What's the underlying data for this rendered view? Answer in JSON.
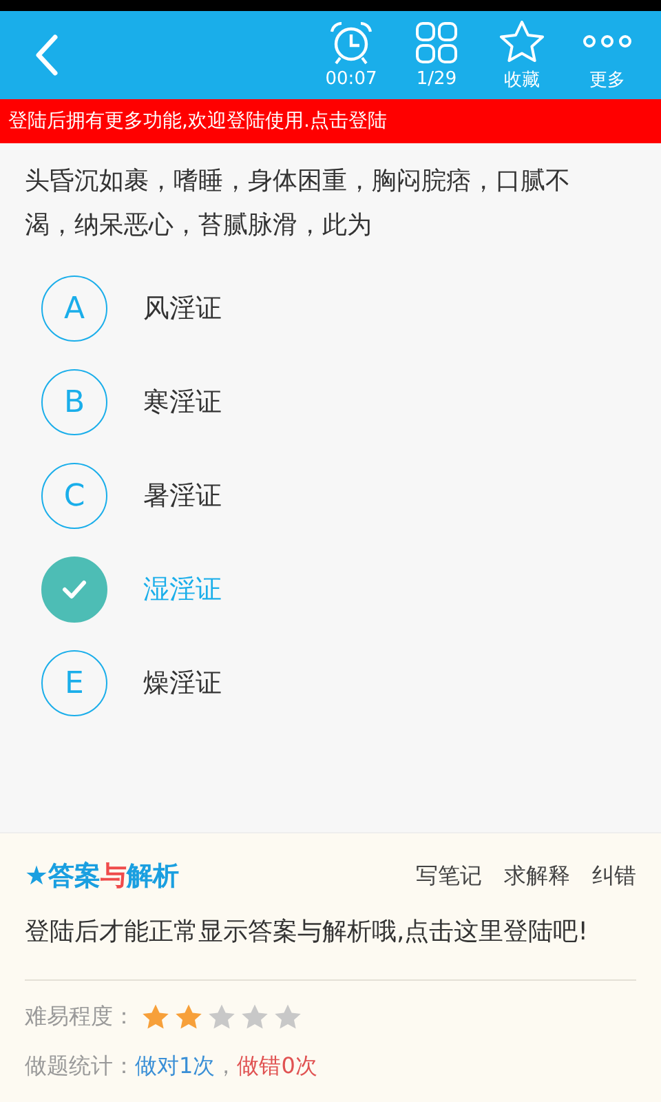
{
  "toolbar": {
    "items": [
      {
        "kind": "alarm",
        "label": "00:07"
      },
      {
        "kind": "grid",
        "label": "1/29"
      },
      {
        "kind": "star",
        "label": "收藏"
      },
      {
        "kind": "more",
        "label": "更多"
      }
    ]
  },
  "login_banner": "登陆后拥有更多功能,欢迎登陆使用.点击登陆",
  "question": "头昏沉如裹，嗜睡，身体困重，胸闷脘痞，口腻不渴，纳呆恶心，苔腻脉滑，此为",
  "options": [
    {
      "letter": "A",
      "text": "风淫证",
      "selected": false
    },
    {
      "letter": "B",
      "text": "寒淫证",
      "selected": false
    },
    {
      "letter": "C",
      "text": "暑淫证",
      "selected": false
    },
    {
      "text": "湿淫证",
      "selected": true
    },
    {
      "letter": "E",
      "text": "燥淫证",
      "selected": false
    }
  ],
  "answer_panel": {
    "title_parts": [
      {
        "text": "★",
        "color": "#1a9fe0"
      },
      {
        "text": "答案",
        "color": "#1a9fe0"
      },
      {
        "text": "与",
        "color": "#ef4b4b"
      },
      {
        "text": "解析",
        "color": "#1a9fe0"
      }
    ],
    "actions": [
      "写笔记",
      "求解释",
      "纠错"
    ],
    "message": "登陆后才能正常显示答案与解析哦,点击这里登陆吧!",
    "difficulty_label": "难易程度：",
    "stars": 2,
    "stats_label": "做题统计：",
    "correct": "做对1次",
    "separator": "，",
    "wrong": "做错0次"
  }
}
